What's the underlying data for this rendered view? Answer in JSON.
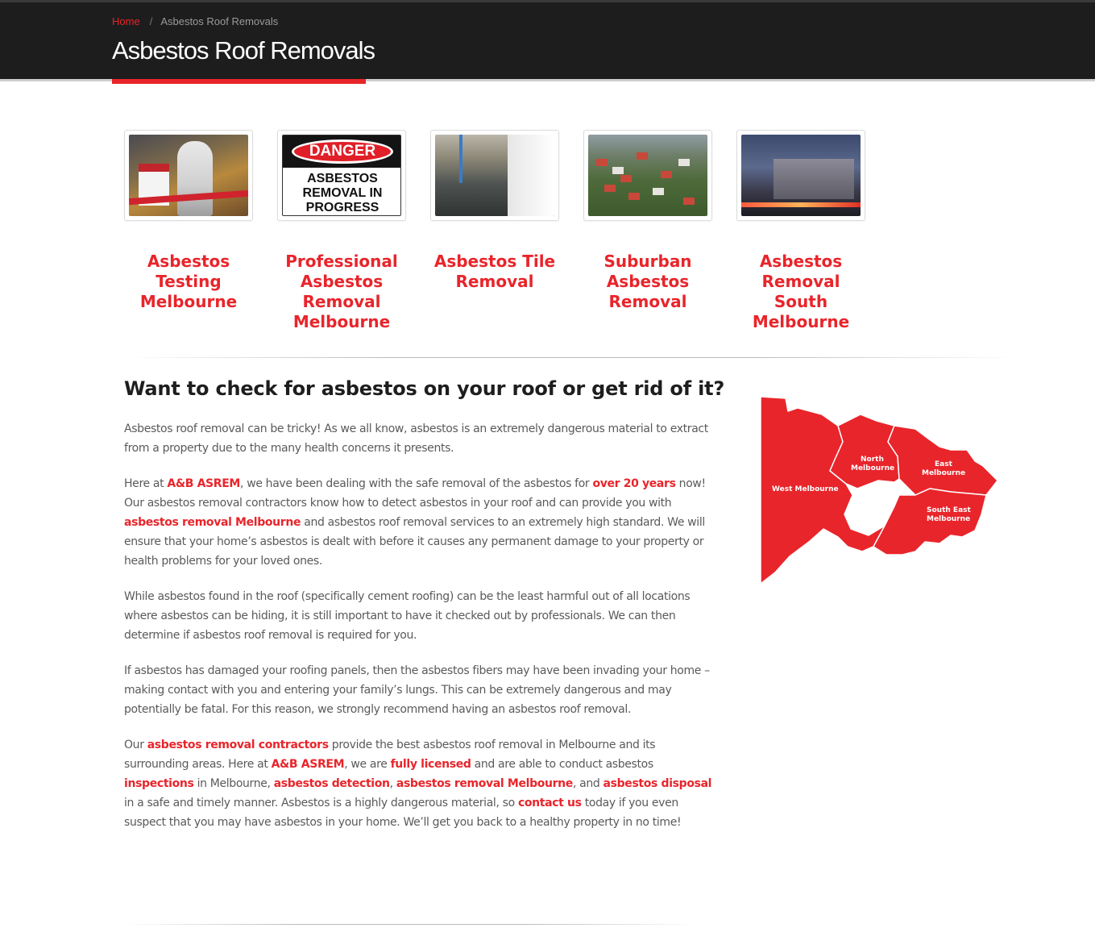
{
  "header": {
    "breadcrumb": {
      "home": "Home",
      "separator": "/",
      "current": "Asbestos Roof Removals"
    },
    "title": "Asbestos Roof Removals"
  },
  "tiles": [
    {
      "caption": "Asbestos Testing Melbourne",
      "image": "asbestos-testing-photo"
    },
    {
      "caption": "Professional Asbestos Removal Melbourne",
      "image": "danger-sign-photo",
      "sign": {
        "danger": "DANGER",
        "line1": "ASBESTOS",
        "line2": "REMOVAL IN",
        "line3": "PROGRESS"
      }
    },
    {
      "caption": "Asbestos Tile Removal",
      "image": "tile-floor-photo"
    },
    {
      "caption": "Suburban Asbestos Removal",
      "image": "suburb-aerial-photo"
    },
    {
      "caption": "Asbestos Removal South Melbourne",
      "image": "south-melbourne-building-photo"
    }
  ],
  "main": {
    "heading": "Want to check for asbestos on your roof or get rid of it?",
    "p1": "Asbestos roof removal can be tricky! As we all know, asbestos is an extremely dangerous material to extract from a property due to the many health concerns it presents.",
    "p2": {
      "t1": "Here at ",
      "l1": "A&B ASREM",
      "t2": ", we have been dealing with the safe removal of the asbestos for ",
      "l2": "over 20 years",
      "t3": " now! Our asbestos removal contractors know how to detect asbestos in your roof and can provide you with ",
      "l3": "asbestos removal Melbourne",
      "t4": " and asbestos roof removal services to an extremely high standard. We will ensure that your home’s asbestos is dealt with before it causes any permanent damage to your property or health problems for your loved ones."
    },
    "p3": "While asbestos found in the roof (specifically cement roofing) can be the least harmful out of all locations where asbestos can be hiding, it is still important to have it checked out by professionals. We can then determine if asbestos roof removal is required for you.",
    "p4": "If asbestos has damaged your roofing panels, then the asbestos fibers may have been invading your home – making contact with you and entering your family’s lungs. This can be extremely dangerous and may potentially be fatal. For this reason, we strongly recommend having an asbestos roof removal.",
    "p5": {
      "t1": "Our ",
      "l1": "asbestos removal contractors",
      "t2": " provide the best asbestos roof removal in Melbourne and its surrounding areas. Here at ",
      "l2": "A&B ASREM",
      "t3": ", we are ",
      "l3": "fully licensed",
      "t4": " and are able to conduct asbestos ",
      "l4": "inspections",
      "t5": " in Melbourne, ",
      "l5": "asbestos detection",
      "t6": ", ",
      "l6": "asbestos removal Melbourne",
      "t7": ", and ",
      "l7": "asbestos disposal",
      "t8": " in a safe and timely manner. Asbestos is a highly dangerous material, so ",
      "l8": "contact us",
      "t9": " today if you even suspect that you may have asbestos in your home. We’ll get you back to a healthy property in no time!"
    }
  },
  "map": {
    "regions": {
      "west": "West Melbourne",
      "north_1": "North",
      "north_2": "Melbourne",
      "east_1": "East",
      "east_2": "Melbourne",
      "southeast_1": "South East",
      "southeast_2": "Melbourne"
    }
  },
  "colors": {
    "accent": "#e8252b",
    "header_bg": "#1d1d1d",
    "text": "#5a5a5a",
    "heading": "#1e1e1e"
  }
}
